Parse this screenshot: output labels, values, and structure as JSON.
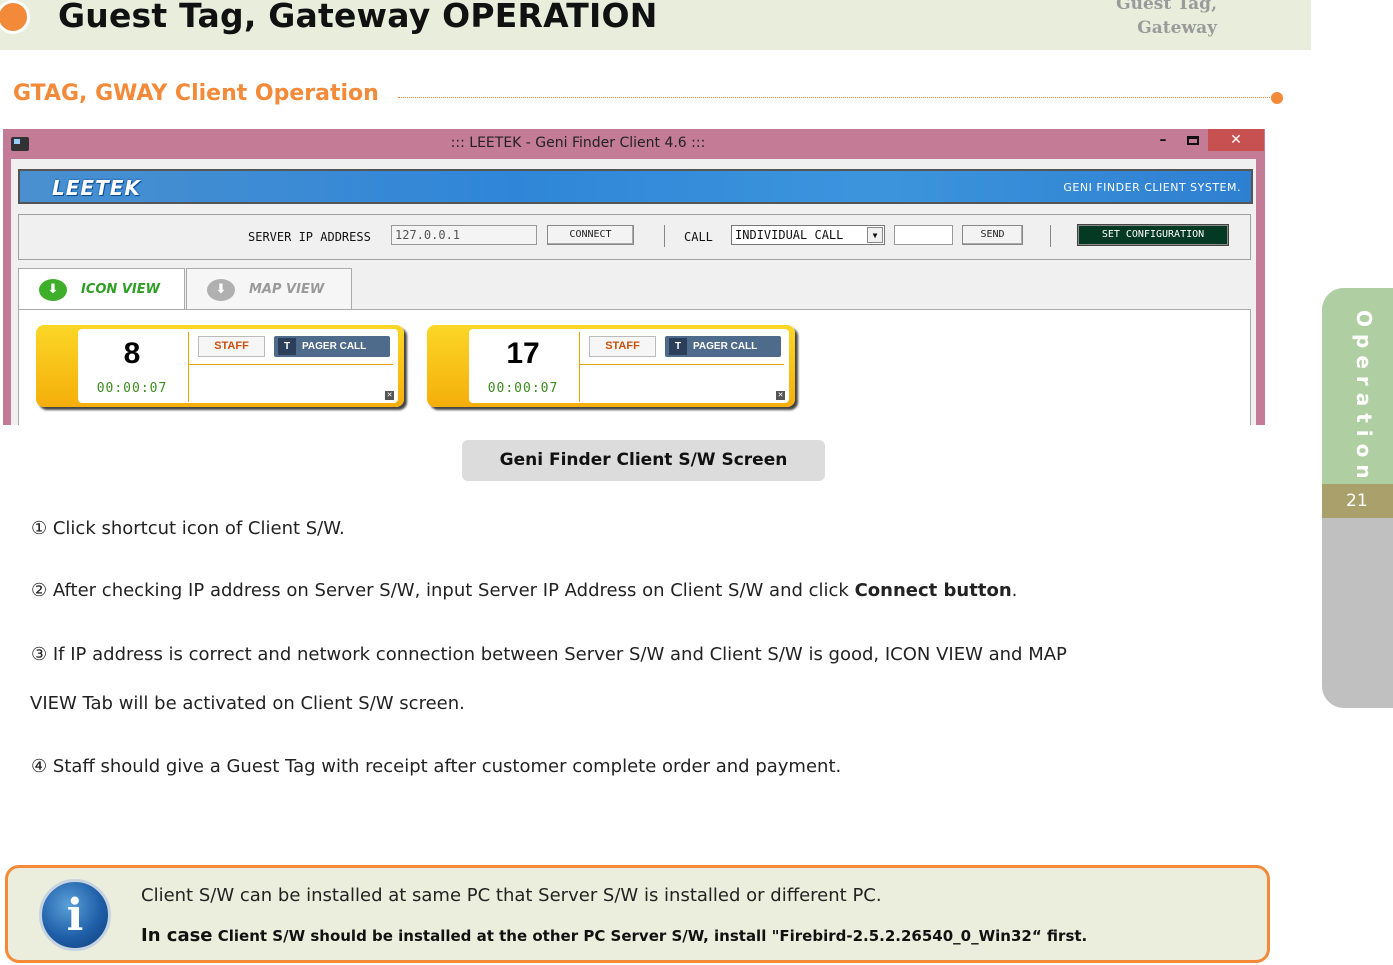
{
  "header": {
    "title": "Guest Tag, Gateway OPERATION",
    "right_label_line1": "Guest Tag,",
    "right_label_line2": "Gateway",
    "accent_color": "#f38a3a"
  },
  "section": {
    "title": "GTAG, GWAY Client Operation"
  },
  "side_tab": {
    "label": "Operation",
    "page_number": "21"
  },
  "app": {
    "window_title": "::: LEETEK - Geni Finder Client 4.6 :::",
    "window_controls": {
      "minimize": "–",
      "close": "✕"
    },
    "banner": {
      "logo": "LEETEK",
      "tagline": "GENI FINDER CLIENT SYSTEM."
    },
    "toolbar": {
      "server_ip_label": "SERVER IP ADDRESS",
      "server_ip_value": "127.0.0.1",
      "connect_label": "CONNECT",
      "call_label": "CALL",
      "call_type_selected": "INDIVIDUAL CALL",
      "call_number_value": "",
      "send_label": "SEND",
      "set_config_label": "SET CONFIGURATION"
    },
    "tabs": [
      {
        "label": "ICON VIEW",
        "active": true
      },
      {
        "label": "MAP VIEW",
        "active": false
      }
    ],
    "tags": [
      {
        "number": "8",
        "elapsed": "00:00:07",
        "staff_label": "STAFF",
        "pager_prefix": "T",
        "pager_label": "PAGER CALL"
      },
      {
        "number": "17",
        "elapsed": "00:00:07",
        "staff_label": "STAFF",
        "pager_prefix": "T",
        "pager_label": "PAGER CALL"
      }
    ]
  },
  "caption": "Geni Finder Client S/W Screen",
  "steps": [
    {
      "text": "① Click shortcut icon of Client S/W."
    },
    {
      "text": "② After checking IP address on Server S/W, input Server IP Address on Client S/W and click ",
      "bold": "Connect button",
      "suffix": "."
    },
    {
      "text": "③ If IP address is correct and network connection between Server S/W and Client S/W is good, ICON VIEW and MAP"
    },
    {
      "text": "VIEW Tab will be activated on Client S/W screen."
    },
    {
      "text": "④ Staff should give a Guest Tag with receipt after customer complete order and payment."
    }
  ],
  "note": {
    "icon": "info-icon",
    "line1": "Client S/W can be installed at same PC that Server S/W is installed or different PC.",
    "line2_lead": "In case",
    "line2_rest": " Client S/W should be installed at the other PC  Server S/W, install \"Firebird-2.5.2.26540_0_Win32“ first."
  }
}
